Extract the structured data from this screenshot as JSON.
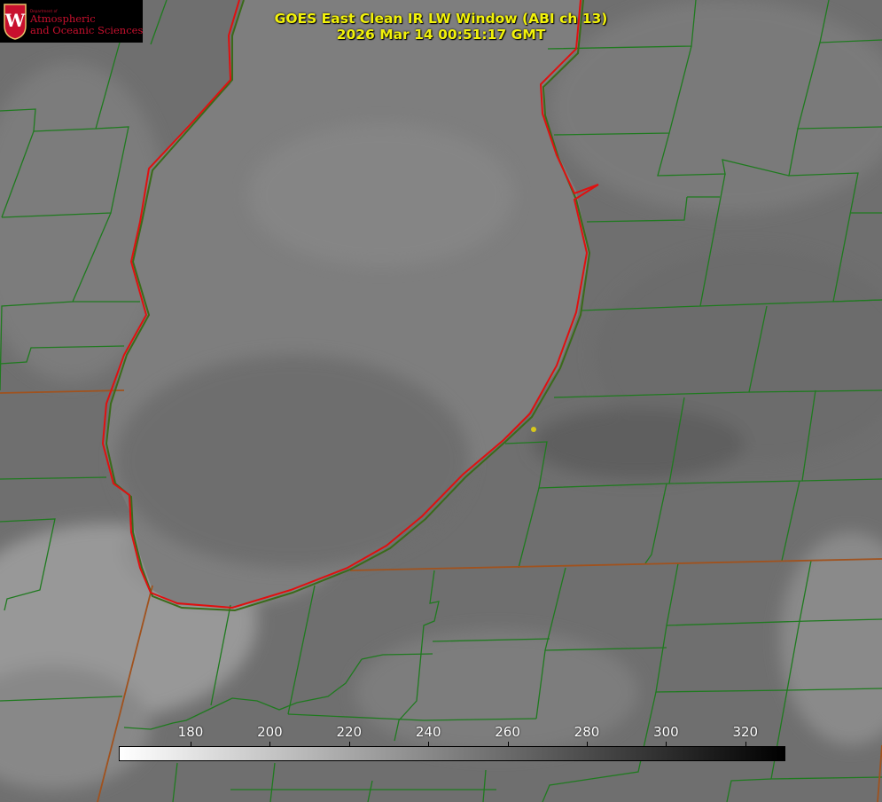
{
  "title": {
    "line1": "GOES East Clean IR LW Window (ABI ch 13)",
    "line2": "2026 Mar 14 00:51:17 GMT"
  },
  "logo": {
    "dept": "Department of",
    "line1": "Atmospheric",
    "line2": "and Oceanic Sciences",
    "crest_letter": "W"
  },
  "colorbar": {
    "ticks": [
      "180",
      "200",
      "220",
      "240",
      "260",
      "280",
      "300",
      "320"
    ],
    "gradient": [
      "#ffffff",
      "#000000"
    ]
  },
  "colors": {
    "county_lines": "#1f7a1f",
    "state_lines": "#a0521e",
    "lake_outline": "#e01010",
    "marker": "#d8c81a",
    "title": "#f2f20a"
  }
}
